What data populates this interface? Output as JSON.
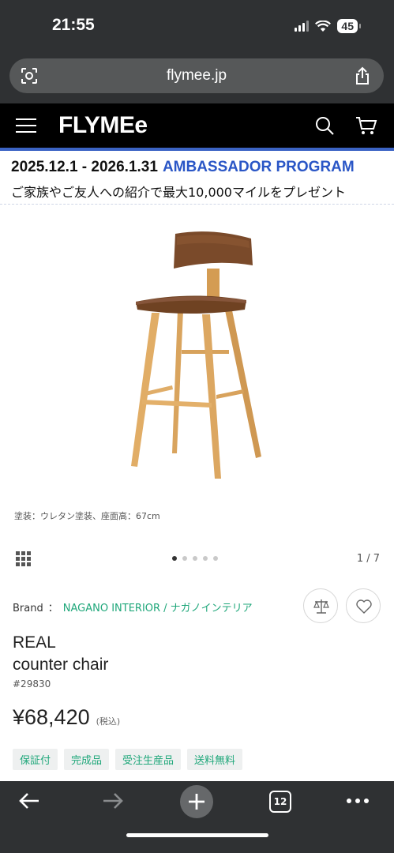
{
  "status_bar": {
    "time": "21:55",
    "battery": "45"
  },
  "browser": {
    "url": "flymee.jp",
    "tab_count": "12"
  },
  "site": {
    "logo": "FLYMEe"
  },
  "banner": {
    "dates": "2025.12.1 - 2026.1.31",
    "program": "AMBASSADOR PROGRAM",
    "subtitle": "ご家族やご友人への紹介で最大10,000マイルをプレゼント"
  },
  "gallery": {
    "caption": "塗装：ウレタン塗装、座面高：67cm",
    "pager": "1 / 7",
    "dot_count": 5,
    "active_dot": 0
  },
  "product": {
    "brand_label": "Brand",
    "brand_sep": "：",
    "brand_name": "NAGANO INTERIOR / ナガノインテリア",
    "name_line1": "REAL",
    "name_line2": "counter chair",
    "id": "#29830",
    "price": "¥68,420",
    "tax_note": "(税込)",
    "tags": [
      "保証付",
      "完成品",
      "受注生産品",
      "送料無料"
    ]
  },
  "colors": {
    "accent_green": "#1fa77a",
    "banner_blue": "#2a56c6",
    "header_line": "#3b63c4",
    "chrome": "#2f3133"
  },
  "icons": {
    "menu": "hamburger-icon",
    "search": "search-icon",
    "cart": "cart-icon",
    "compare": "scale-icon",
    "favorite": "heart-icon",
    "grid": "grid-icon",
    "back": "arrow-left-icon",
    "forward": "arrow-right-icon",
    "new_tab": "plus-icon",
    "more": "more-icon"
  }
}
